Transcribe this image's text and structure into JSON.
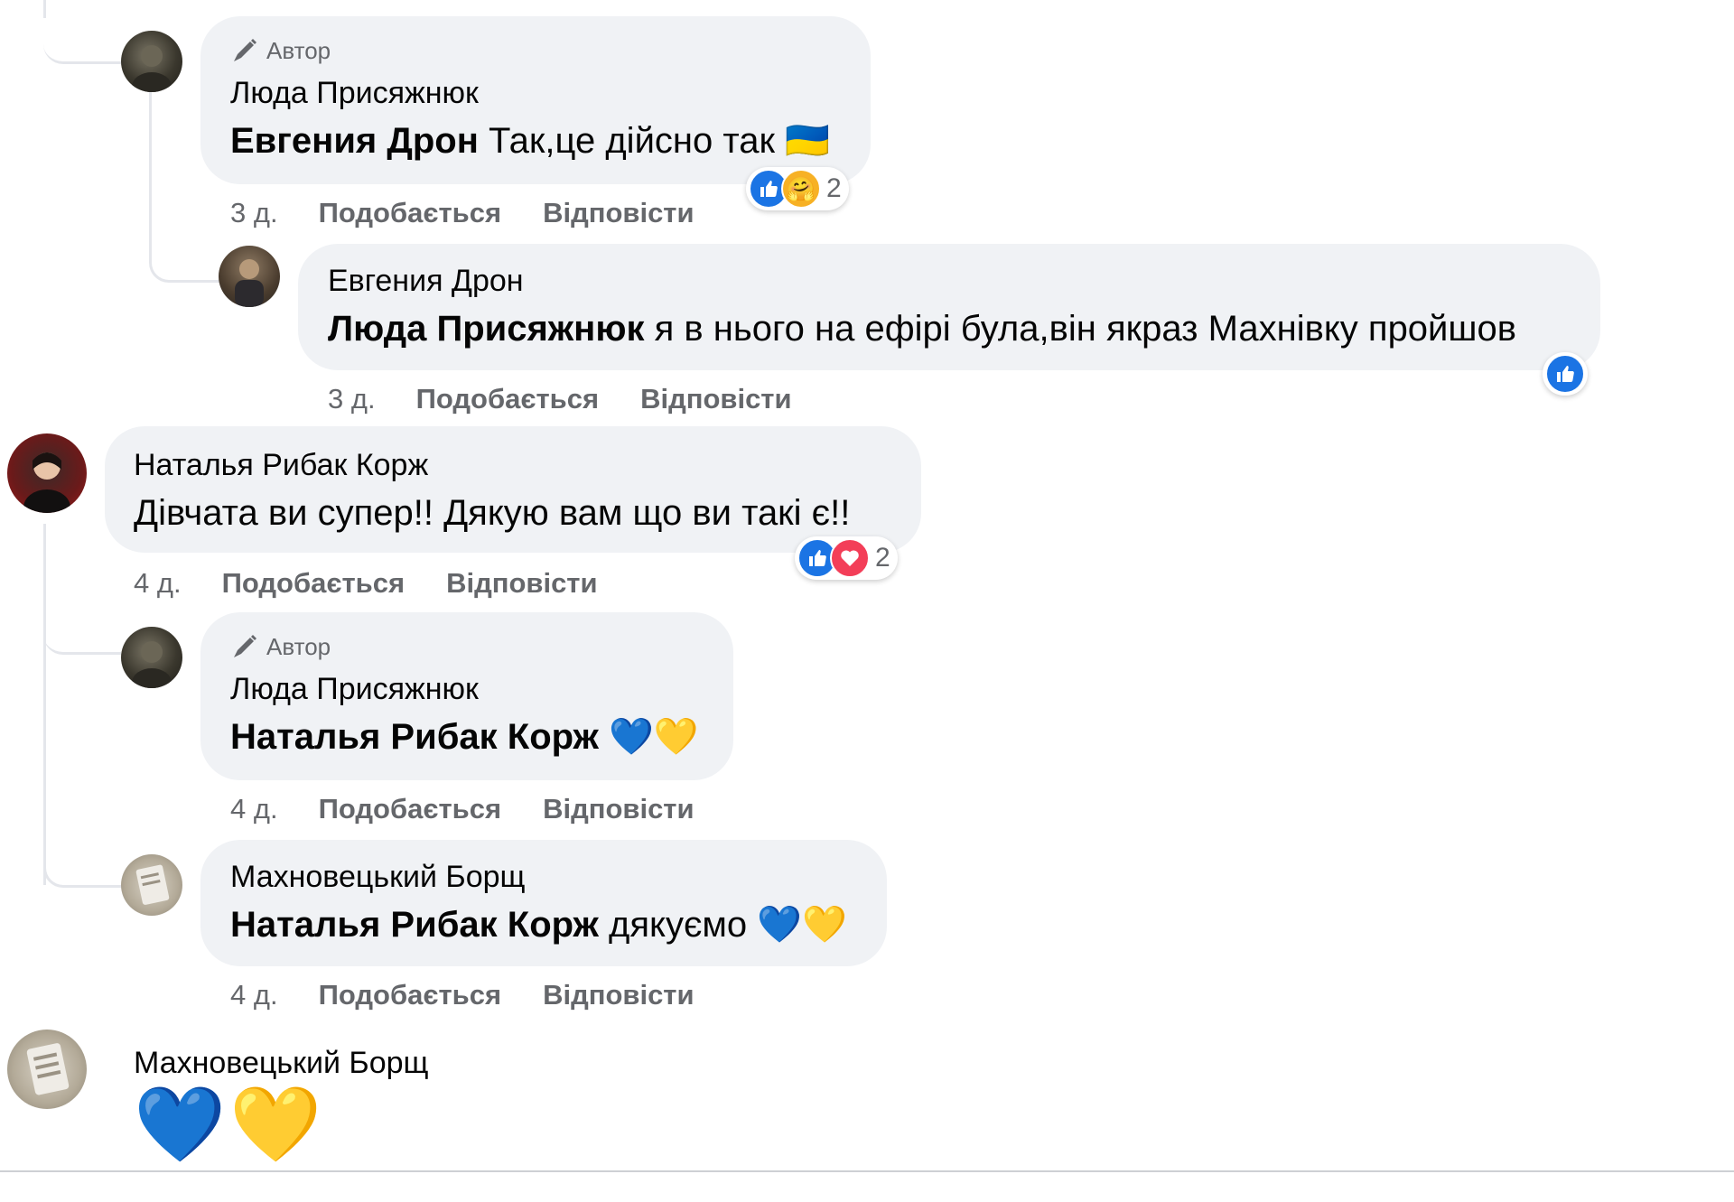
{
  "comments": [
    {
      "author_badge": "Автор",
      "name": "Люда Присяжнюк",
      "mention": "Евгения Дрон",
      "text": " Так,це дійсно так ",
      "emoji": "🇺🇦",
      "time": "3 д.",
      "like": "Подобається",
      "reply": "Відповісти",
      "reactions": [
        "like",
        "care"
      ],
      "reaction_count": "2"
    },
    {
      "name": "Евгения Дрон",
      "mention": "Люда Присяжнюк",
      "text": " я в нього на ефірі була,він якраз Махнівку пройшов",
      "time": "3 д.",
      "like": "Подобається",
      "reply": "Відповісти",
      "reactions": [
        "like"
      ]
    },
    {
      "name": "Наталья Рибак Корж",
      "text": "Дівчата ви супер!! Дякую вам що ви такі є!!",
      "time": "4 д.",
      "like": "Подобається",
      "reply": "Відповісти",
      "reactions": [
        "like",
        "love"
      ],
      "reaction_count": "2"
    },
    {
      "author_badge": "Автор",
      "name": "Люда Присяжнюк",
      "mention": "Наталья Рибак Корж",
      "text": " ",
      "emoji": "💙💛",
      "time": "4 д.",
      "like": "Подобається",
      "reply": "Відповісти"
    },
    {
      "name": "Махновецький Борщ",
      "mention": "Наталья Рибак Корж",
      "text": " дякуємо ",
      "emoji": "💙💛",
      "time": "4 д.",
      "like": "Подобається",
      "reply": "Відповісти"
    },
    {
      "name": "Махновецький Борщ",
      "emoji": "💙💛"
    }
  ],
  "colors": {
    "bubble": "#f0f2f5",
    "meta": "#65676b",
    "like_blue": "#1b74e4",
    "love_red": "#f33e58"
  }
}
